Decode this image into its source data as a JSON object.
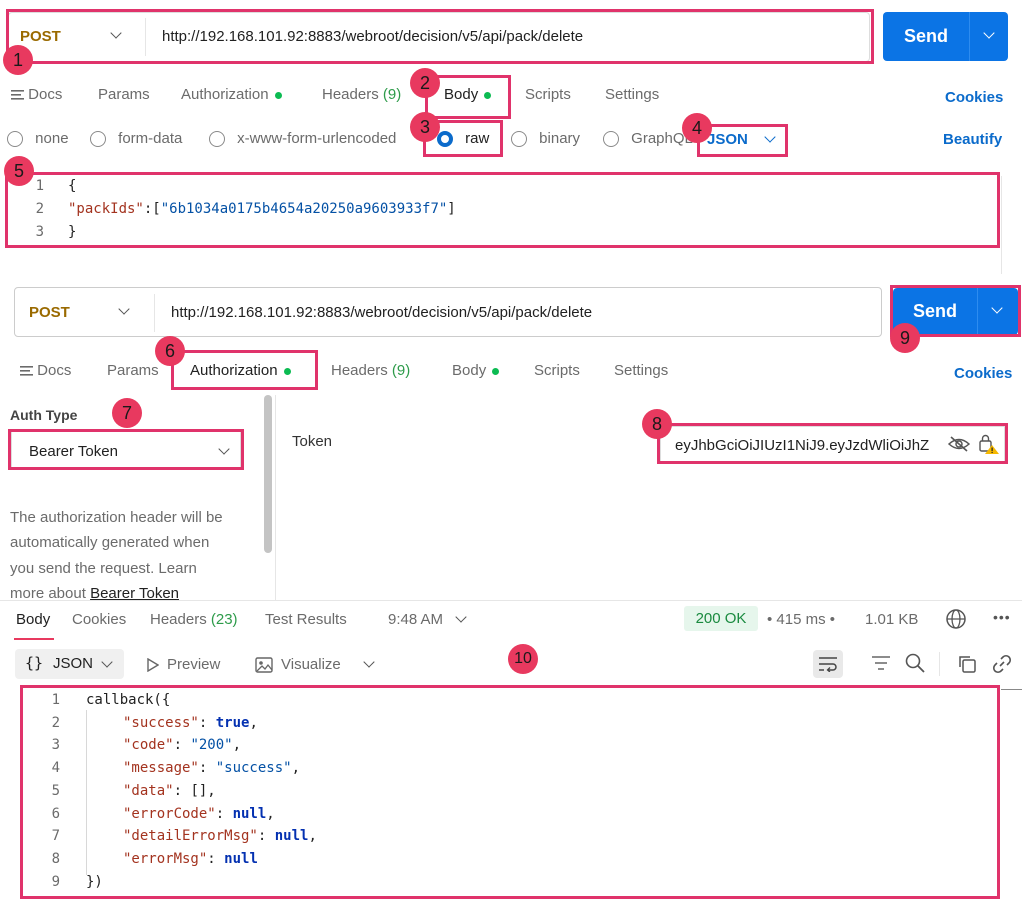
{
  "request1": {
    "method": "POST",
    "url": "http://192.168.101.92:8883/webroot/decision/v5/api/pack/delete",
    "send_label": "Send",
    "tabs": [
      {
        "label": "Docs"
      },
      {
        "label": "Params"
      },
      {
        "label": "Authorization"
      },
      {
        "label": "Headers",
        "count": "(9)"
      },
      {
        "label": "Body"
      },
      {
        "label": "Scripts"
      },
      {
        "label": "Settings"
      }
    ],
    "cookies_label": "Cookies",
    "body_modes": [
      "none",
      "form-data",
      "x-www-form-urlencoded",
      "raw",
      "binary",
      "GraphQL"
    ],
    "format": "JSON",
    "beautify_label": "Beautify",
    "body_lines": [
      {
        "n": "1",
        "text": "{"
      },
      {
        "n": "2",
        "key": "\"packIds\"",
        "rest": ":[",
        "str": "\"6b1034a0175b4654a20250a9603933f7\"",
        "end": "]"
      },
      {
        "n": "3",
        "text": "}"
      }
    ]
  },
  "request2": {
    "method": "POST",
    "url": "http://192.168.101.92:8883/webroot/decision/v5/api/pack/delete",
    "send_label": "Send",
    "tabs": [
      {
        "label": "Docs"
      },
      {
        "label": "Params"
      },
      {
        "label": "Authorization"
      },
      {
        "label": "Headers",
        "count": "(9)"
      },
      {
        "label": "Body"
      },
      {
        "label": "Scripts"
      },
      {
        "label": "Settings"
      }
    ],
    "cookies_label": "Cookies",
    "auth_type_label": "Auth Type",
    "auth_type_value": "Bearer Token",
    "auth_help": [
      "The authorization header will be",
      "automatically generated when",
      "you send the request. Learn",
      "more about"
    ],
    "auth_help_link": "Bearer Token",
    "token_label": "Token",
    "token_value": "eyJhbGciOiJIUzI1NiJ9.eyJzdWliOiJhZ"
  },
  "response": {
    "tabs": [
      {
        "label": "Body"
      },
      {
        "label": "Cookies"
      },
      {
        "label": "Headers",
        "count": "(23)"
      },
      {
        "label": "Test Results"
      }
    ],
    "time_label": "9:48 AM",
    "status": "200 OK",
    "duration": "415 ms",
    "size": "1.01 KB",
    "format": "JSON",
    "preview_label": "Preview",
    "visualize_label": "Visualize",
    "lines": [
      {
        "n": "1",
        "p": "callback({"
      },
      {
        "n": "2",
        "k": "\"success\"",
        "v": "true",
        "t": "kw",
        "c": ","
      },
      {
        "n": "3",
        "k": "\"code\"",
        "v": "\"200\"",
        "t": "s",
        "c": ","
      },
      {
        "n": "4",
        "k": "\"message\"",
        "v": "\"success\"",
        "t": "s",
        "c": ","
      },
      {
        "n": "5",
        "k": "\"data\"",
        "v": "[]",
        "t": "p",
        "c": ","
      },
      {
        "n": "6",
        "k": "\"errorCode\"",
        "v": "null",
        "t": "kw",
        "c": ","
      },
      {
        "n": "7",
        "k": "\"detailErrorMsg\"",
        "v": "null",
        "t": "kw",
        "c": ","
      },
      {
        "n": "8",
        "k": "\"errorMsg\"",
        "v": "null",
        "t": "kw",
        "c": ""
      },
      {
        "n": "9",
        "p": "})"
      }
    ]
  },
  "annotations": [
    "1",
    "2",
    "3",
    "4",
    "5",
    "6",
    "7",
    "8",
    "9",
    "10"
  ],
  "colors": {
    "accent": "#0b74e5",
    "highlight": "#e0336b",
    "status_ok": "#0cbb52"
  }
}
